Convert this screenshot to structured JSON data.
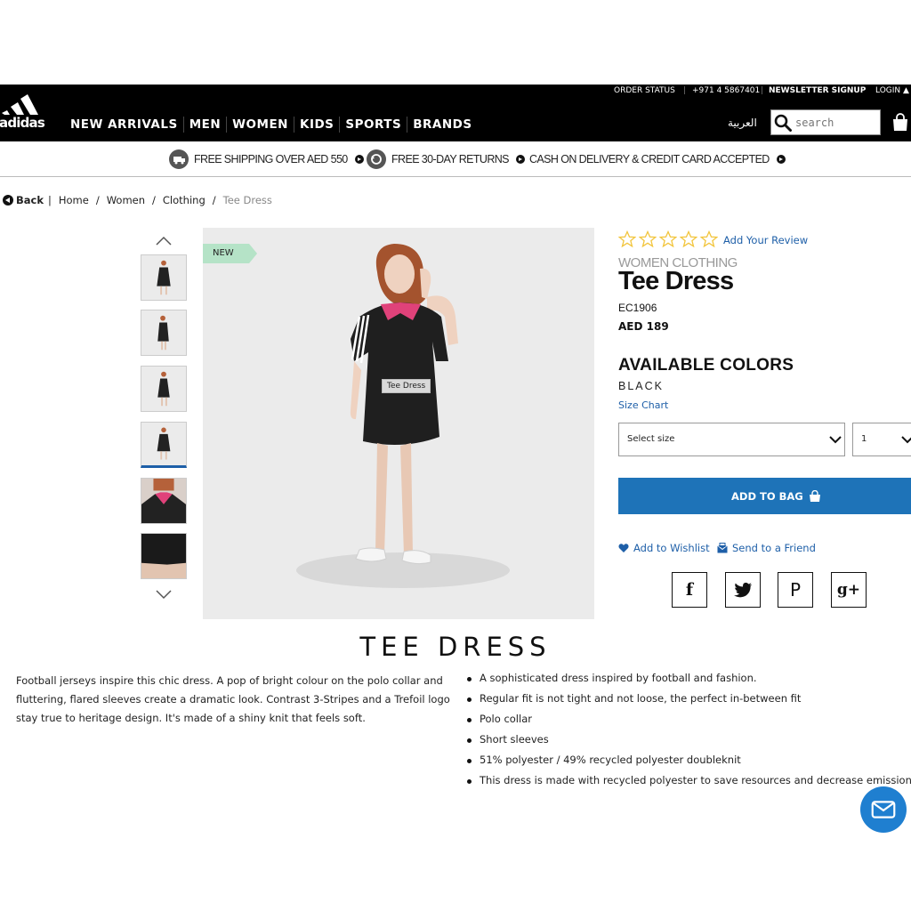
{
  "utility_bar": {
    "order_status": "ORDER STATUS",
    "phone": "+971 4 5867401",
    "newsletter": "NEWSLETTER SIGNUP",
    "login": "LOGIN"
  },
  "logo": {
    "text": "adidas"
  },
  "nav": {
    "items": [
      "NEW ARRIVALS",
      "MEN",
      "WOMEN",
      "KIDS",
      "SPORTS",
      "BRANDS"
    ],
    "language": "العربية",
    "search_placeholder": "search"
  },
  "promo": {
    "items": [
      "FREE SHIPPING OVER AED 550",
      "FREE 30-DAY RETURNS",
      "CASH ON DELIVERY & CREDIT CARD ACCEPTED"
    ]
  },
  "breadcrumb": {
    "back": "Back",
    "items": [
      "Home",
      "Women",
      "Clothing"
    ],
    "current": "Tee Dress"
  },
  "gallery": {
    "badge": "NEW",
    "tooltip": "Tee Dress",
    "thumbnail_count": 6,
    "active_thumbnail": 4
  },
  "product": {
    "rating_stars": 5,
    "rating_value": 0,
    "add_review": "Add Your Review",
    "category": "WOMEN CLOTHING",
    "title": "Tee Dress",
    "sku": "EC1906",
    "price": "AED 189",
    "available_colors_heading": "AVAILABLE COLORS",
    "color": "BLACK",
    "size_chart": "Size Chart",
    "size_select": "Select size",
    "quantity": "1",
    "add_to_bag": "ADD TO BAG",
    "wishlist": "Add to Wishlist",
    "send_friend": "Send to a Friend",
    "social": [
      "f",
      "twitter",
      "P",
      "g+"
    ]
  },
  "description": {
    "heading": "TEE DRESS",
    "text": "Football jerseys inspire this chic dress. A pop of bright colour on the polo collar and fluttering, flared sleeves create a dramatic look. Contrast 3-Stripes and a Trefoil logo stay true to heritage design. It's made of a shiny knit that feels soft.",
    "features": [
      "A sophisticated dress inspired by football and fashion.",
      "Regular fit is not tight and not loose, the perfect in-between fit",
      "Polo collar",
      "Short sleeves",
      "51% polyester / 49% recycled polyester doubleknit",
      "This dress is made with recycled polyester to save resources and decrease emissions"
    ]
  },
  "colors": {
    "header_bg": "#000000",
    "link_blue": "#1e5fa8",
    "add_to_bag_bg": "#1e73b8",
    "star_color": "#f2c53d",
    "new_badge_bg": "#b5e3c7",
    "collar_pink": "#e0427a"
  }
}
